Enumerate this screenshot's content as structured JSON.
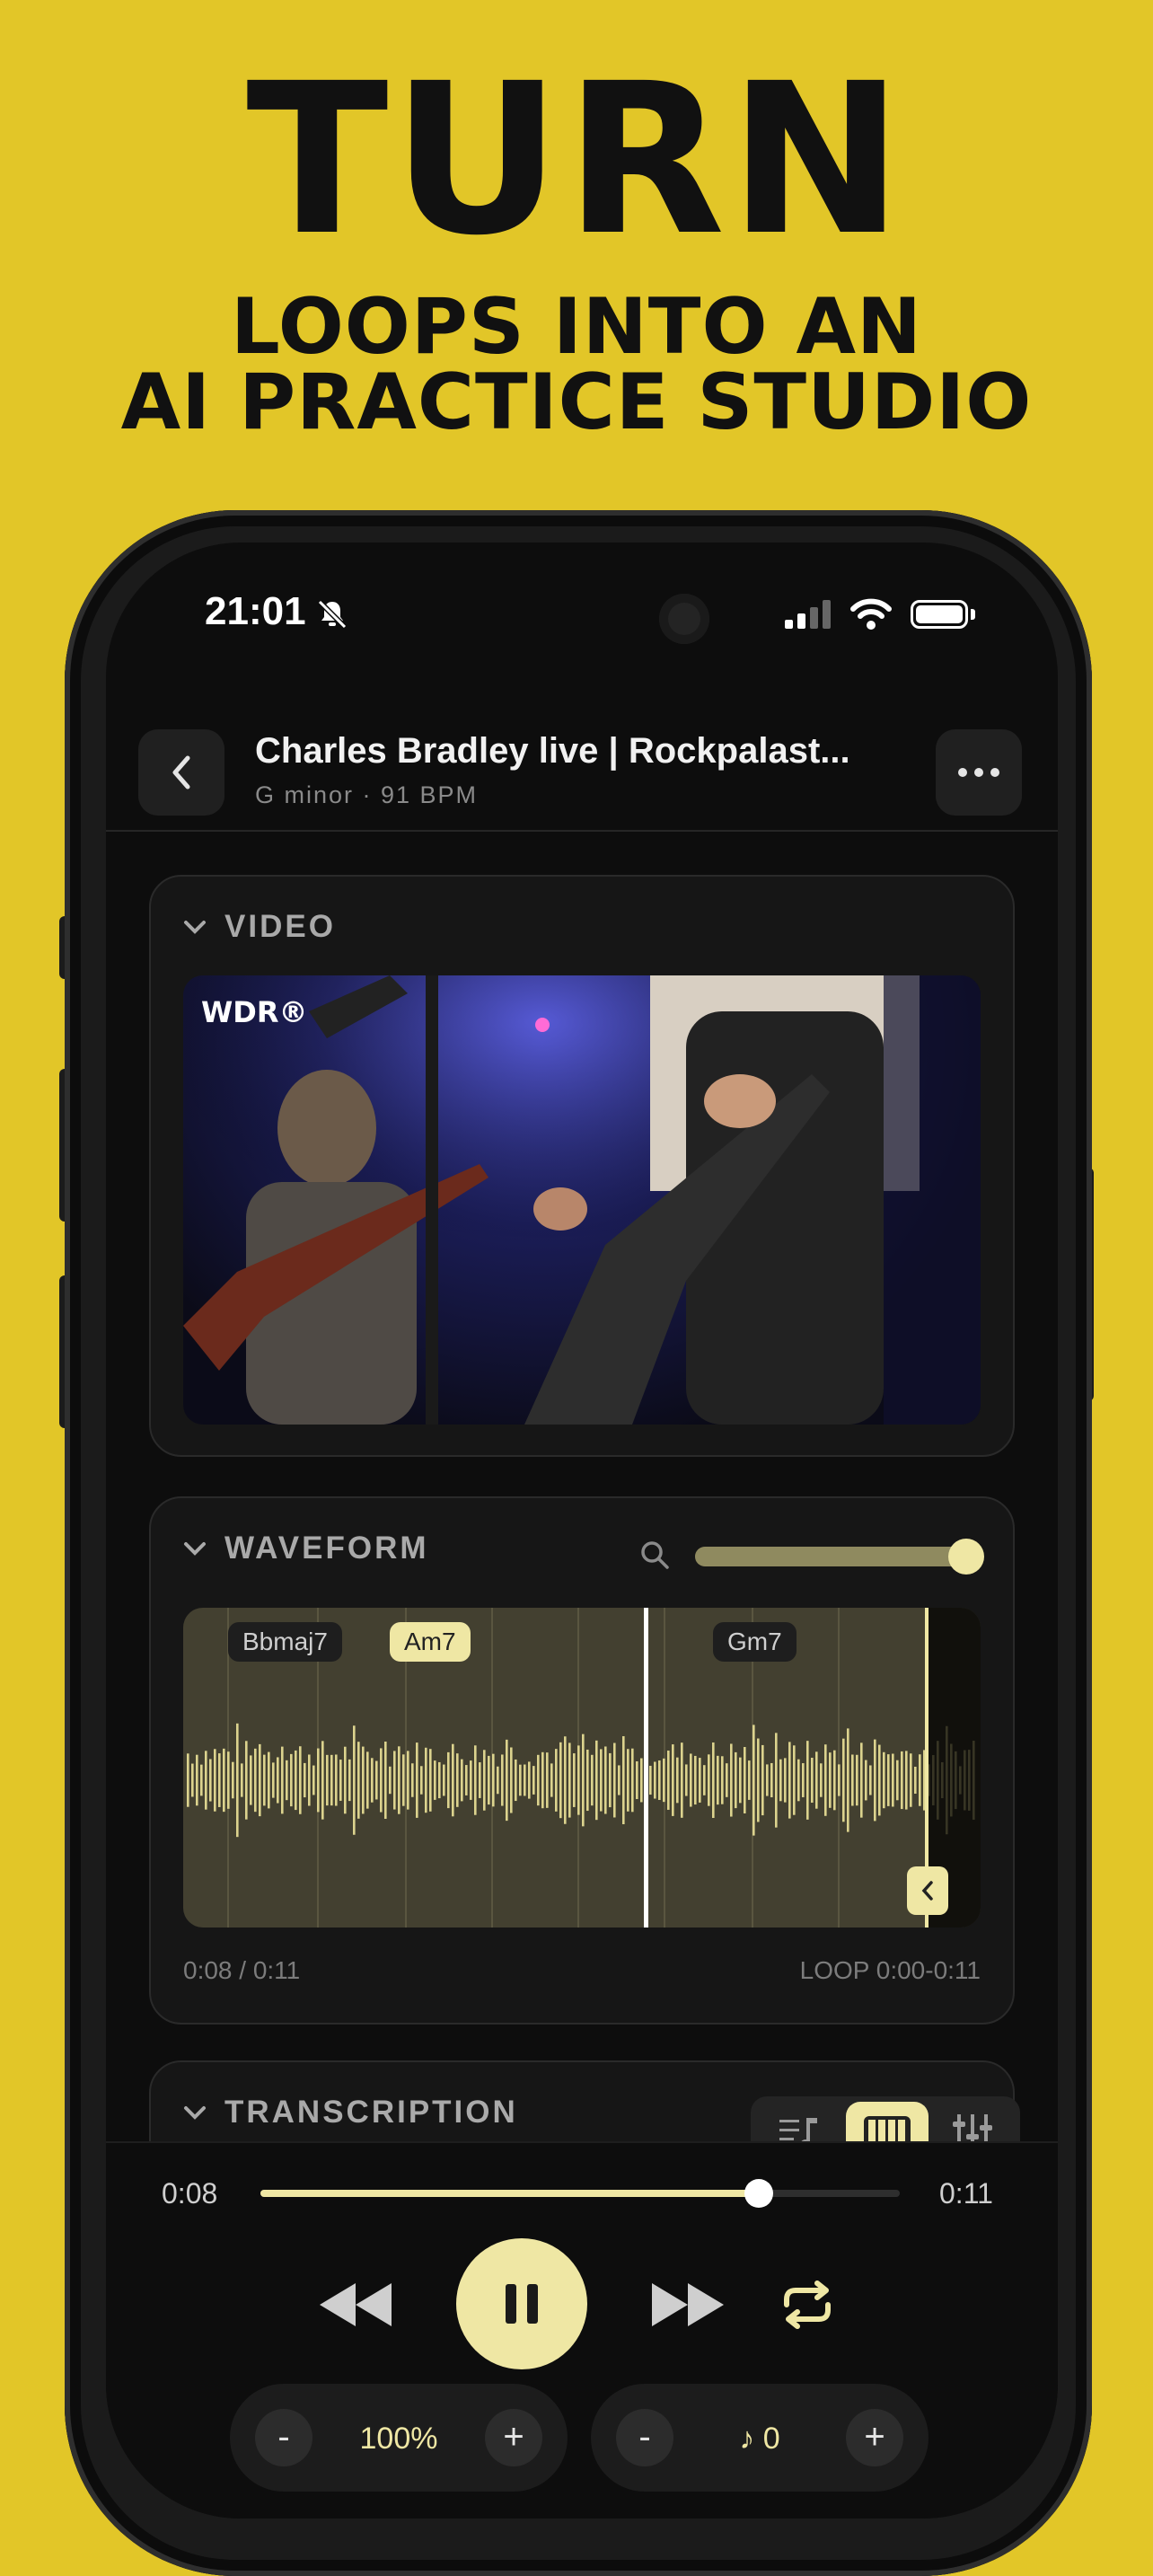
{
  "headline": {
    "main": "TURN",
    "line1": "LOOPS INTO AN",
    "line2": "AI PRACTICE STUDIO"
  },
  "status_bar": {
    "time": "21:01",
    "icons": [
      "bell-slash-icon",
      "signal-icon",
      "wifi-icon",
      "battery-icon"
    ]
  },
  "nav": {
    "title": "Charles Bradley live | Rockpalast...",
    "subtitle": "G minor · 91 BPM"
  },
  "video_section": {
    "title": "VIDEO",
    "watermark": "WDR®"
  },
  "waveform_section": {
    "title": "WAVEFORM",
    "zoom_level": 0.95,
    "chords": [
      {
        "label": "Bbmaj7",
        "active": false
      },
      {
        "label": "Am7",
        "active": true
      },
      {
        "label": "Gm7",
        "active": false
      }
    ],
    "playhead_fraction": 0.58,
    "time_readout": "0:08 / 0:11",
    "loop_readout": "LOOP 0:00-0:11"
  },
  "transcription_section": {
    "title": "TRANSCRIPTION",
    "tabs": [
      "sheet-icon",
      "piano-icon",
      "mixer-icon"
    ],
    "active_tab": 1
  },
  "player": {
    "current": "0:08",
    "total": "0:11",
    "progress": 0.78,
    "speed": "100%",
    "pitch": "0"
  },
  "colors": {
    "background": "#E2C628",
    "accent": "#EFE7A4",
    "screen": "#0d0d0d"
  }
}
